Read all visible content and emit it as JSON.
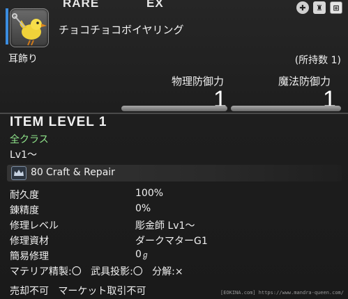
{
  "header": {
    "rarity": "RARE",
    "ex": "EX"
  },
  "item": {
    "name": "チョコチョコボイヤリング",
    "slot": "耳飾り",
    "owned": "(所持数 1)"
  },
  "stats": [
    {
      "label": "物理防御力",
      "value": "1"
    },
    {
      "label": "魔法防御力",
      "value": "1"
    }
  ],
  "item_level": "ITEM LEVEL 1",
  "classes": "全クラス",
  "required_level": "Lv1～",
  "craft": {
    "level": "80",
    "name": "Craft & Repair"
  },
  "repair_info": [
    {
      "label": "耐久度",
      "value": "100%"
    },
    {
      "label": "錬精度",
      "value": "0%"
    },
    {
      "label": "修理レベル",
      "value": "彫金師 Lv1～"
    },
    {
      "label": "修理資材",
      "value": "ダークマターG1"
    },
    {
      "label": "簡易修理",
      "value": "0"
    }
  ],
  "materia_line": "マテリア精製:〇   武具投影:〇   分解:×",
  "flags_line": "売却不可   マーケット取引不可",
  "credit": "[EOKINA.com] https://www.mandra-queen.com/",
  "colors": {
    "class_text": "#8fe38a",
    "accent": "#3b8de0"
  }
}
